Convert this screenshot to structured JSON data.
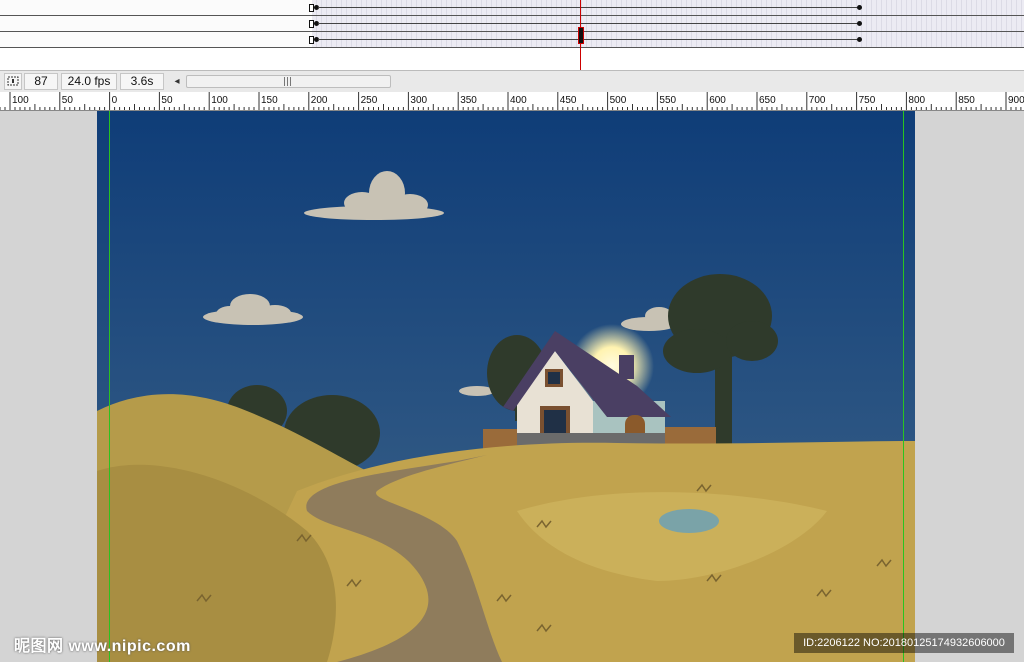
{
  "status": {
    "current_frame": "87",
    "frame_rate": "24.0 fps",
    "elapsed_time": "3.6s",
    "scroll_grip": "|||",
    "scroll_left_arrow": "◂"
  },
  "ruler": {
    "labels": [
      "100",
      "50",
      "0",
      "50",
      "100",
      "150",
      "200",
      "250",
      "300",
      "350",
      "400",
      "450",
      "500",
      "550",
      "600",
      "650",
      "700",
      "750",
      "800",
      "850",
      "900"
    ]
  },
  "watermark": {
    "logo_text": "昵图网 www.nipic.com",
    "id_text": "ID:2206122 NO:20180125174932606000"
  },
  "colors": {
    "sky_top": "#0f3d78",
    "sky_bottom": "#3f6589",
    "hill": "#b59b4a",
    "path": "#8f7c5c",
    "guide": "#29c41f",
    "playhead": "#cc0000"
  }
}
